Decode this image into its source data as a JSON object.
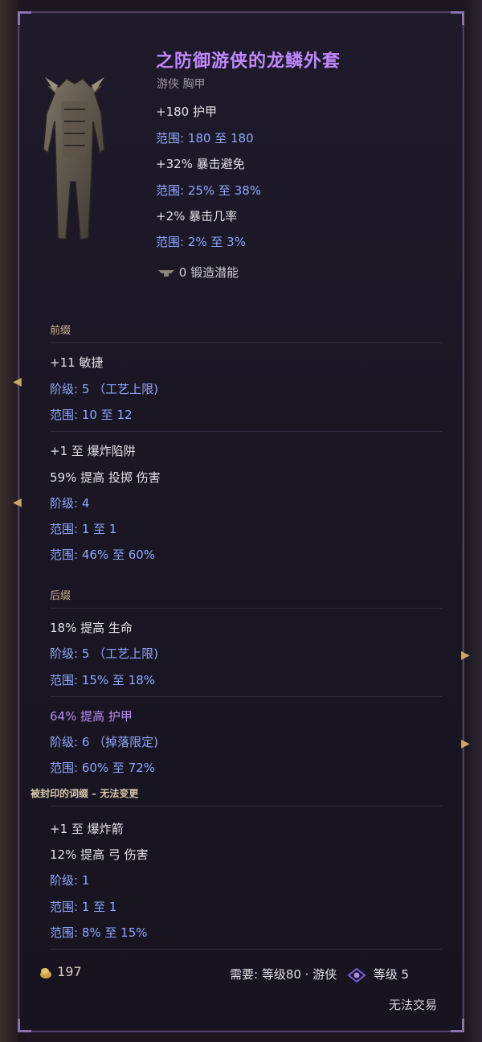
{
  "item": {
    "name": "之防御游侠的龙鳞外套",
    "type": "游侠 胸甲",
    "implicits": [
      {
        "stat": "+180 护甲",
        "range": "范围: 180 至 180"
      },
      {
        "stat": "+32% 暴击避免",
        "range": "范围: 25% 至 38%"
      },
      {
        "stat": "+2% 暴击几率",
        "range": "范围: 2% 至 3%"
      }
    ],
    "forging_potential": "0 锻造潜能"
  },
  "prefix": {
    "header": "前缀",
    "affix1": {
      "stat": "+11 敏捷",
      "tier": "阶级: 5 （工艺上限)",
      "range": "范围: 10 至 12"
    },
    "affix2": {
      "stat1": "+1 至 爆炸陷阱",
      "stat2": "59% 提高 投掷 伤害",
      "tier": "阶级: 4",
      "range1": "范围: 1 至 1",
      "range2": "范围: 46% 至 60%"
    }
  },
  "suffix": {
    "header": "后缀",
    "affix1": {
      "stat": "18% 提高 生命",
      "tier": "阶级: 5 （工艺上限)",
      "range": "范围: 15% 至 18%"
    },
    "affix2": {
      "stat": "64% 提高 护甲",
      "tier": "阶级: 6 （掉落限定)",
      "range": "范围: 60% 至 72%"
    }
  },
  "sealed": {
    "header": "被封印的词缀 – 无法变更",
    "stat1": "+1 至 爆炸箭",
    "stat2": "12% 提高 弓 伤害",
    "tier": "阶级: 1",
    "range1": "范围: 1 至 1",
    "range2": "范围: 8% 至 15%"
  },
  "footer": {
    "gold": "197",
    "requirement": "需要: 等级80 · 游侠",
    "legendary_level": "等级 5",
    "trade": "无法交易"
  },
  "colors": {
    "title": "#c088ff",
    "range_blue": "#8fa8ff",
    "sealed_purple": "#b98cf2",
    "header_gold": "#cbb58c"
  },
  "icons": [
    "armor-image",
    "forge-anvil-icon",
    "gold-coin-icon",
    "legendary-rank-icon"
  ]
}
